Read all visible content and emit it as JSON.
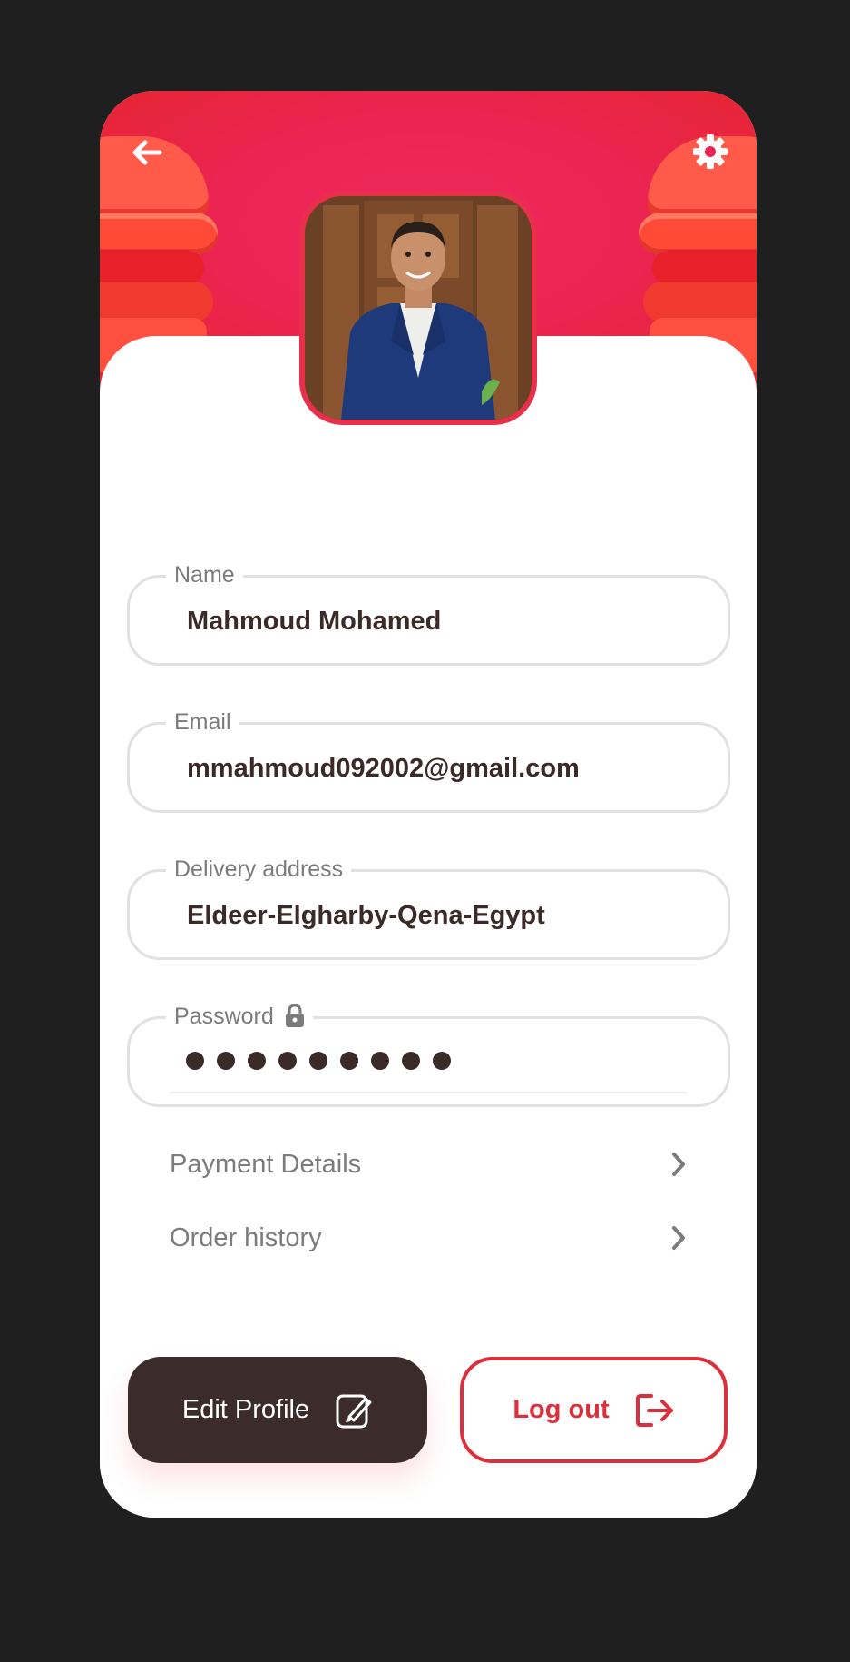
{
  "header": {
    "back_icon": "arrow-left-icon",
    "settings_icon": "gear-icon"
  },
  "profile": {
    "photo": "profile-photo"
  },
  "fields": {
    "name": {
      "label": "Name",
      "value": "Mahmoud Mohamed"
    },
    "email": {
      "label": "Email",
      "value": "mmahmoud092002@gmail.com"
    },
    "address": {
      "label": "Delivery address",
      "value": "Eldeer-Elgharby-Qena-Egypt"
    },
    "password": {
      "label": "Password",
      "masked_length": 9,
      "icon": "lock-icon"
    }
  },
  "menu": {
    "payment": "Payment Details",
    "orders": "Order history"
  },
  "actions": {
    "edit_label": "Edit Profile",
    "logout_label": "Log out"
  },
  "colors": {
    "accent": "#dc2f3c",
    "header_pink": "#ec2453",
    "dark_button": "#3b2c2b"
  }
}
